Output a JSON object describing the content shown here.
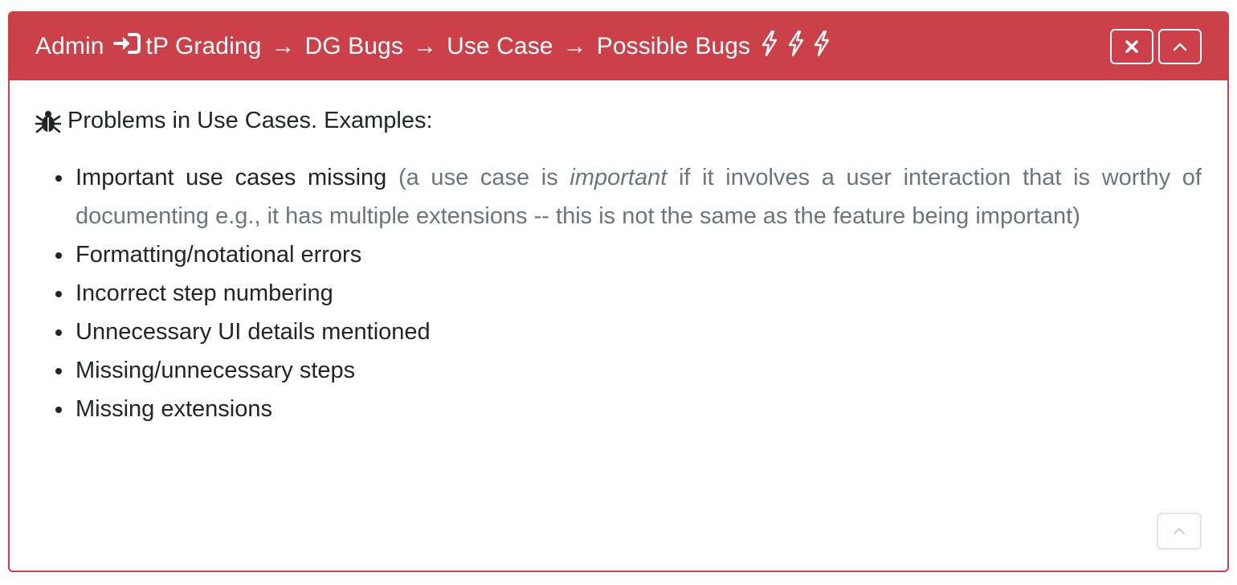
{
  "header": {
    "breadcrumb": {
      "first": "Admin",
      "second": "tP Grading",
      "third": "DG Bugs",
      "fourth": "Use Case",
      "fifth": "Possible Bugs",
      "separator": "→"
    },
    "icons": [
      "login-icon",
      "bolt-icon",
      "bolt-icon",
      "bolt-icon"
    ],
    "bg_color": "#cc4149",
    "close_button_icon": "close-icon",
    "collapse_button_icon": "chevron-up-icon"
  },
  "body": {
    "intro_icon": "bug-icon",
    "intro_text": "Problems in Use Cases. Examples:",
    "items": [
      {
        "main": "Important use cases missing",
        "note_prefix": "(a use case is ",
        "note_em": "important",
        "note_suffix": " if it involves a user interaction that is worthy of documenting e.g., it has multiple extensions -- this is not the same as the feature being important)"
      },
      {
        "main": "Formatting/notational errors"
      },
      {
        "main": "Incorrect step numbering"
      },
      {
        "main": "Unnecessary UI details mentioned"
      },
      {
        "main": "Missing/unnecessary steps"
      },
      {
        "main": "Missing extensions"
      }
    ]
  },
  "footer": {
    "scroll_top_icon": "chevron-up-icon"
  }
}
